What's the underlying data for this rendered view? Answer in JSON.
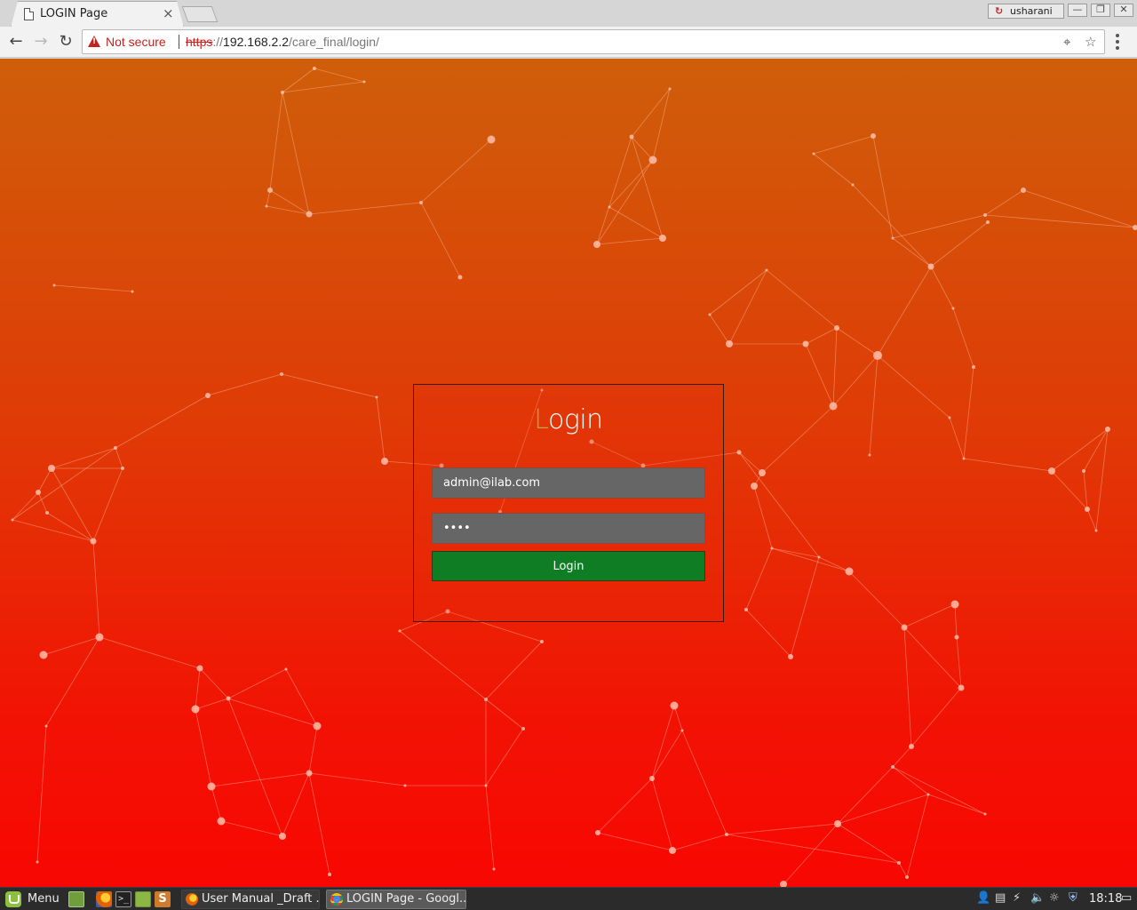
{
  "browser": {
    "tab_title": "LOGIN Page",
    "tab_close": "×",
    "profile_name": "usharani",
    "window_buttons": {
      "minimize": "—",
      "restore": "❐",
      "close": "✕"
    }
  },
  "toolbar": {
    "back": "←",
    "forward": "→",
    "reload": "↻",
    "security_label": "Not secure",
    "url_scheme": "https",
    "url_separator": "://",
    "url_host": "192.168.2.2",
    "url_path": "/care_final/login/",
    "location_icon": "⌖",
    "star_icon": "☆"
  },
  "login": {
    "title_first": "L",
    "title_rest": "ogin",
    "email_value": "admin@ilab.com",
    "password_value": "••••",
    "button_label": "Login"
  },
  "colors": {
    "background_top": "#cf5e0a",
    "background_bottom": "#f80702",
    "login_button": "#0e7d24",
    "field_background": "#666666"
  },
  "taskbar": {
    "menu_label": "Menu",
    "launchers": [
      "show-desktop-icon",
      "firefox-icon",
      "terminal-icon",
      "files-icon",
      "sublime-icon"
    ],
    "tasks": [
      {
        "label": "User Manual _Draft ...",
        "icon": "firefox-icon"
      },
      {
        "label": "LOGIN Page - Googl...",
        "icon": "chrome-icon"
      }
    ],
    "clock": "18:18"
  }
}
